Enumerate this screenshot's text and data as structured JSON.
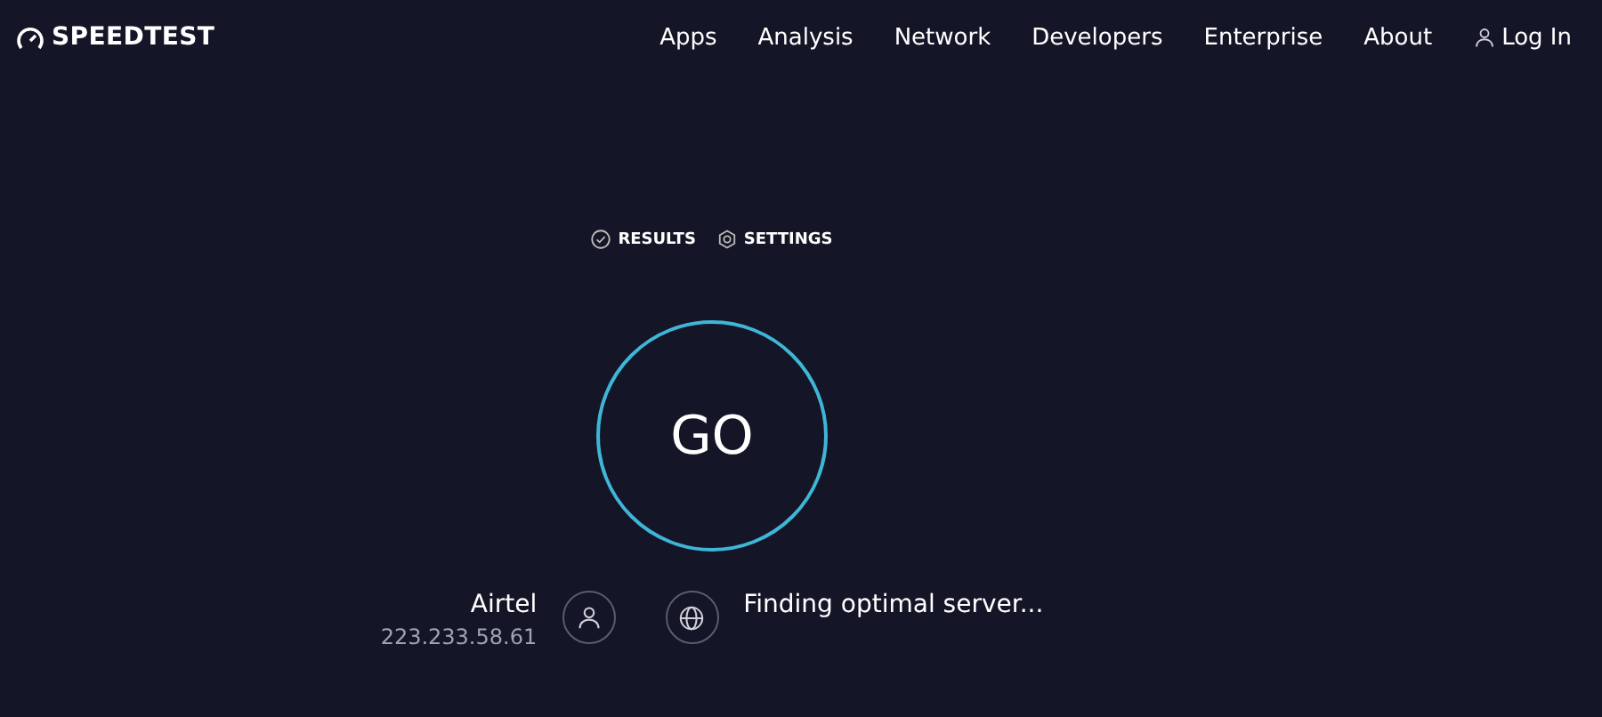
{
  "logo": {
    "text": "SPEEDTEST"
  },
  "nav": [
    {
      "label": "Apps"
    },
    {
      "label": "Analysis"
    },
    {
      "label": "Network"
    },
    {
      "label": "Developers"
    },
    {
      "label": "Enterprise"
    },
    {
      "label": "About"
    }
  ],
  "login": {
    "label": "Log In"
  },
  "tabs": [
    {
      "label": "RESULTS",
      "kind": "results"
    },
    {
      "label": "SETTINGS",
      "kind": "settings"
    }
  ],
  "go_button": {
    "label": "GO"
  },
  "isp": {
    "name": "Airtel",
    "ip": "223.233.58.61"
  },
  "server": {
    "status": "Finding optimal server..."
  }
}
